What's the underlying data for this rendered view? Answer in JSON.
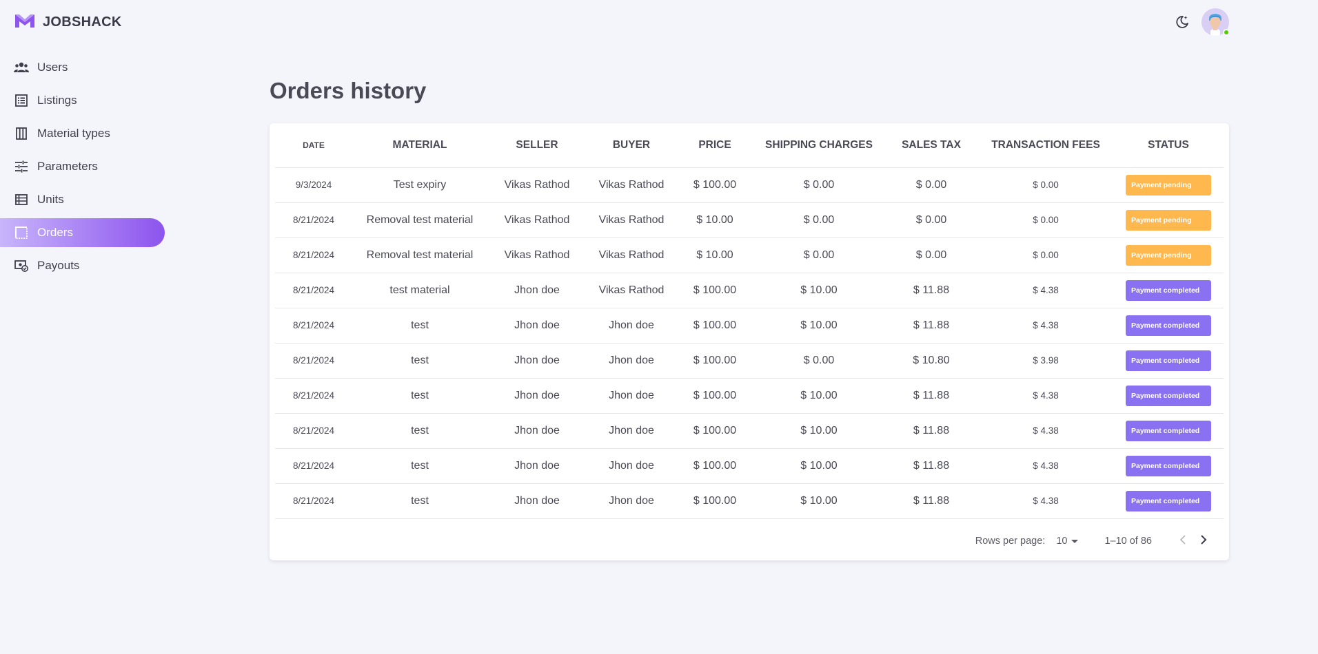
{
  "brand": {
    "name": "JOBSHACK",
    "color": "#8d54ee"
  },
  "sidebar": {
    "items": [
      {
        "label": "Users",
        "icon": "users-icon",
        "active": false
      },
      {
        "label": "Listings",
        "icon": "list-icon",
        "active": false
      },
      {
        "label": "Material types",
        "icon": "columns-icon",
        "active": false
      },
      {
        "label": "Parameters",
        "icon": "sliders-icon",
        "active": false
      },
      {
        "label": "Units",
        "icon": "table-icon",
        "active": false
      },
      {
        "label": "Orders",
        "icon": "orders-icon",
        "active": true
      },
      {
        "label": "Payouts",
        "icon": "payouts-icon",
        "active": false
      }
    ]
  },
  "header": {
    "theme_icon": "moon-icon",
    "avatar_status": "online"
  },
  "main": {
    "title": "Orders history",
    "table": {
      "columns": [
        "DATE",
        "MATERIAL",
        "SELLER",
        "BUYER",
        "PRICE",
        "SHIPPING CHARGES",
        "SALES TAX",
        "TRANSACTION FEES",
        "STATUS"
      ],
      "rows": [
        {
          "date": "9/3/2024",
          "material": "Test expiry",
          "seller": "Vikas Rathod",
          "buyer": "Vikas Rathod",
          "price": "$ 100.00",
          "shipping": "$ 0.00",
          "tax": "$ 0.00",
          "fees": "$ 0.00",
          "status": "Payment pending",
          "status_type": "pending"
        },
        {
          "date": "8/21/2024",
          "material": "Removal test material",
          "seller": "Vikas Rathod",
          "buyer": "Vikas Rathod",
          "price": "$ 10.00",
          "shipping": "$ 0.00",
          "tax": "$ 0.00",
          "fees": "$ 0.00",
          "status": "Payment pending",
          "status_type": "pending"
        },
        {
          "date": "8/21/2024",
          "material": "Removal test material",
          "seller": "Vikas Rathod",
          "buyer": "Vikas Rathod",
          "price": "$ 10.00",
          "shipping": "$ 0.00",
          "tax": "$ 0.00",
          "fees": "$ 0.00",
          "status": "Payment pending",
          "status_type": "pending"
        },
        {
          "date": "8/21/2024",
          "material": "test material",
          "seller": "Jhon doe",
          "buyer": "Vikas Rathod",
          "price": "$ 100.00",
          "shipping": "$ 10.00",
          "tax": "$ 11.88",
          "fees": "$ 4.38",
          "status": "Payment completed",
          "status_type": "completed"
        },
        {
          "date": "8/21/2024",
          "material": "test",
          "seller": "Jhon doe",
          "buyer": "Jhon doe",
          "price": "$ 100.00",
          "shipping": "$ 10.00",
          "tax": "$ 11.88",
          "fees": "$ 4.38",
          "status": "Payment completed",
          "status_type": "completed"
        },
        {
          "date": "8/21/2024",
          "material": "test",
          "seller": "Jhon doe",
          "buyer": "Jhon doe",
          "price": "$ 100.00",
          "shipping": "$ 0.00",
          "tax": "$ 10.80",
          "fees": "$ 3.98",
          "status": "Payment completed",
          "status_type": "completed"
        },
        {
          "date": "8/21/2024",
          "material": "test",
          "seller": "Jhon doe",
          "buyer": "Jhon doe",
          "price": "$ 100.00",
          "shipping": "$ 10.00",
          "tax": "$ 11.88",
          "fees": "$ 4.38",
          "status": "Payment completed",
          "status_type": "completed"
        },
        {
          "date": "8/21/2024",
          "material": "test",
          "seller": "Jhon doe",
          "buyer": "Jhon doe",
          "price": "$ 100.00",
          "shipping": "$ 10.00",
          "tax": "$ 11.88",
          "fees": "$ 4.38",
          "status": "Payment completed",
          "status_type": "completed"
        },
        {
          "date": "8/21/2024",
          "material": "test",
          "seller": "Jhon doe",
          "buyer": "Jhon doe",
          "price": "$ 100.00",
          "shipping": "$ 10.00",
          "tax": "$ 11.88",
          "fees": "$ 4.38",
          "status": "Payment completed",
          "status_type": "completed"
        },
        {
          "date": "8/21/2024",
          "material": "test",
          "seller": "Jhon doe",
          "buyer": "Jhon doe",
          "price": "$ 100.00",
          "shipping": "$ 10.00",
          "tax": "$ 11.88",
          "fees": "$ 4.38",
          "status": "Payment completed",
          "status_type": "completed"
        }
      ]
    },
    "pagination": {
      "rows_per_page_label": "Rows per page:",
      "rows_per_page_value": "10",
      "range": "1–10 of 86"
    }
  },
  "colors": {
    "accent": "#8d54ee",
    "pending": "#ffb84d",
    "completed": "#8a71f2",
    "online": "#56ca00"
  }
}
